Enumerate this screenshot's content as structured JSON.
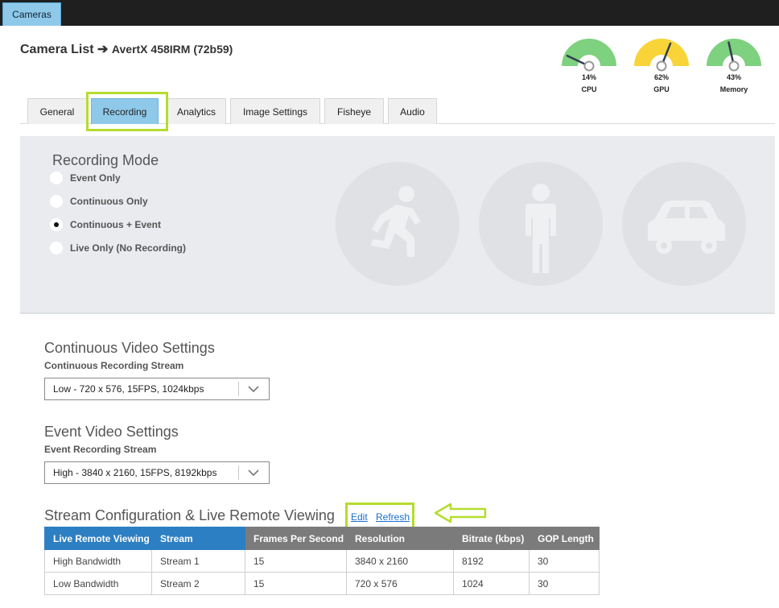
{
  "app_tab": "Cameras",
  "header": {
    "crumb_root": "Camera List",
    "crumb_sep": "➔",
    "crumb_current": "AvertX 458IRM (72b59)"
  },
  "gauges": [
    {
      "label": "CPU",
      "percent_text": "14%",
      "value": 14,
      "color": "#7ed17e"
    },
    {
      "label": "GPU",
      "percent_text": "62%",
      "value": 62,
      "color": "#f8d439"
    },
    {
      "label": "Memory",
      "percent_text": "43%",
      "value": 43,
      "color": "#7ed17e"
    }
  ],
  "tabs": [
    "General",
    "Recording",
    "Analytics",
    "Image Settings",
    "Fisheye",
    "Audio"
  ],
  "active_tab": "Recording",
  "recording_mode": {
    "title": "Recording Mode",
    "options": [
      "Event Only",
      "Continuous Only",
      "Continuous + Event",
      "Live Only (No Recording)"
    ],
    "selected": "Continuous + Event"
  },
  "analytics_icons": [
    "running-person-icon",
    "standing-person-icon",
    "car-icon"
  ],
  "continuous": {
    "title": "Continuous Video Settings",
    "field_label": "Continuous Recording Stream",
    "value": "Low - 720 x 576, 15FPS, 1024kbps"
  },
  "event": {
    "title": "Event Video Settings",
    "field_label": "Event Recording Stream",
    "value": "High - 3840 x 2160, 15FPS, 8192kbps"
  },
  "stream_config": {
    "title": "Stream Configuration & Live Remote Viewing",
    "edit_label": "Edit",
    "refresh_label": "Refresh",
    "columns": [
      "Live Remote Viewing",
      "Stream",
      "Frames Per Second",
      "Resolution",
      "Bitrate (kbps)",
      "GOP Length"
    ],
    "rows": [
      [
        "High Bandwidth",
        "Stream 1",
        "15",
        "3840 x 2160",
        "8192",
        "30"
      ],
      [
        "Low Bandwidth",
        "Stream 2",
        "15",
        "720 x 576",
        "1024",
        "30"
      ]
    ]
  },
  "colors": {
    "accent": "#8fc9ea",
    "highlight": "#b5dc2e",
    "table_blue": "#2d7fc3",
    "table_grey": "#7b7b7b",
    "link": "#1a6fd0"
  }
}
